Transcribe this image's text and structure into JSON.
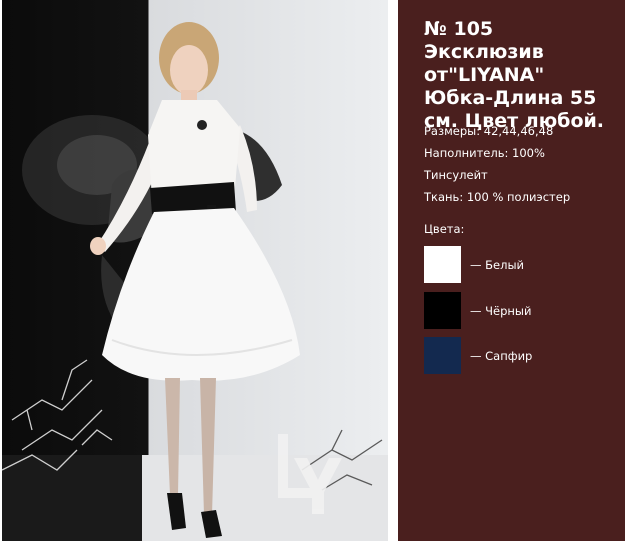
{
  "product": {
    "title": "№ 105 Эксклюзив от\"LIYANA\" Юбка-Длина 55 см. Цвет любой.",
    "specs": [
      "Размеры: 42,44,46,48",
      "Наполнитель: 100%",
      "Тинсулейт",
      "Ткань: 100 % полиэстер"
    ],
    "colors_label": "Цвета:",
    "colors": [
      {
        "label": "— Белый",
        "hex": "#ffffff"
      },
      {
        "label": "— Чёрный",
        "hex": "#000000"
      },
      {
        "label": "— Сапфир",
        "hex": "#13294f"
      }
    ]
  },
  "photo": {
    "logo_text": "LY"
  },
  "theme": {
    "panel_bg": "#4a1f1e"
  }
}
